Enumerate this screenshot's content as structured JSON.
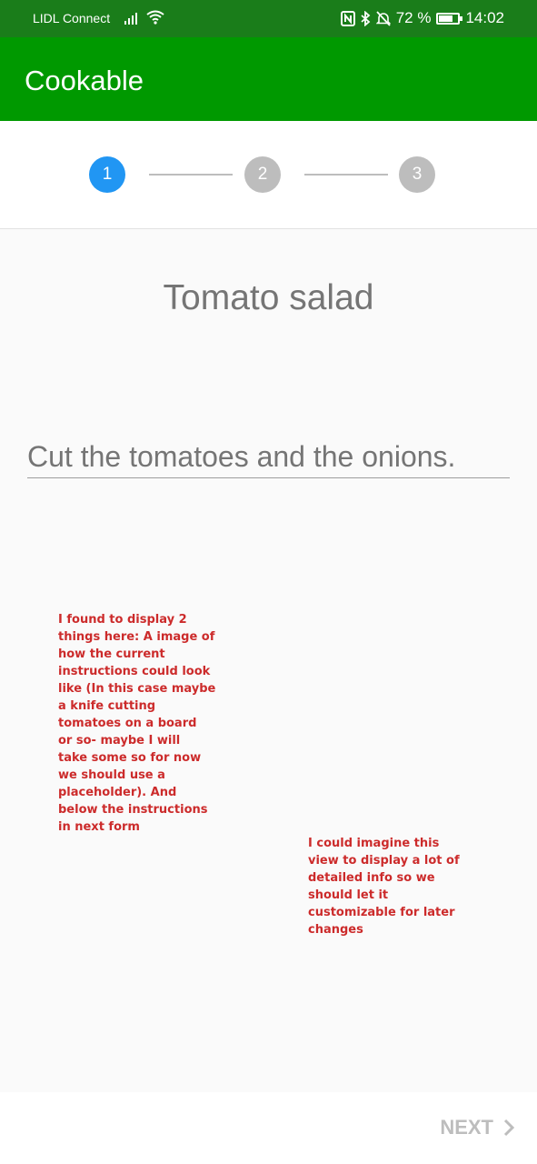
{
  "status_bar": {
    "carrier": "LIDL Connect",
    "battery_text": "72 %",
    "battery_level": 0.72,
    "time": "14:02"
  },
  "app_bar": {
    "title": "Cookable"
  },
  "stepper": {
    "steps": [
      {
        "label": "1",
        "active": true
      },
      {
        "label": "2",
        "active": false
      },
      {
        "label": "3",
        "active": false
      }
    ],
    "active_color": "#2196f3",
    "inactive_color": "#bdbdbd"
  },
  "content": {
    "recipe_title": "Tomato salad",
    "instruction_placeholder": "Cut the tomatoes and the onions."
  },
  "annotations": {
    "note_1": "I found to display 2\nthings here: A image of\nhow the current\ninstructions could look\nlike (In this case maybe\na knife cutting\ntomatoes on a board\nor so- maybe  I will\ntake some so for now\nwe should use a\nplaceholder). And\nbelow the instructions\nin next form",
    "note_2": "I could imagine this\nview to display a lot of\ndetailed info so we\nshould let it\ncustomizable for later\nchanges"
  },
  "bottom_bar": {
    "next_label": "NEXT"
  },
  "colors": {
    "status_bar": "#1a7d1a",
    "app_bar": "#009900",
    "note_text": "#cc2b2b"
  }
}
